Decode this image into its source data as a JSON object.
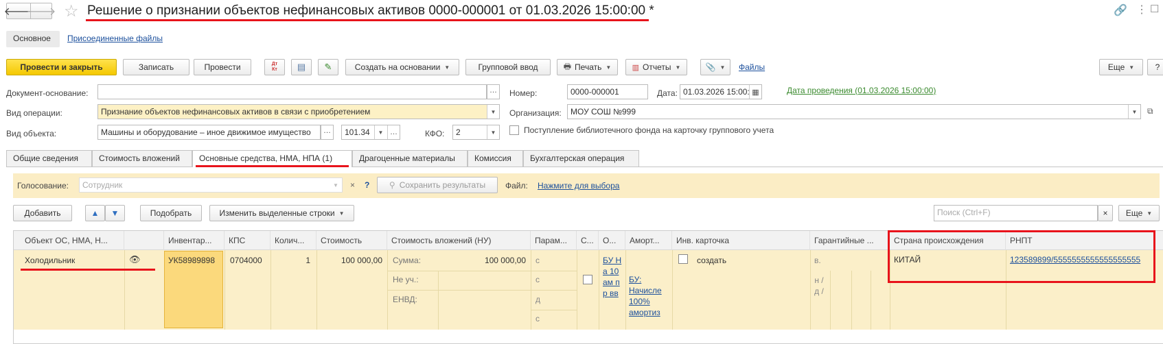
{
  "title": "Решение о признании объектов нефинансовых активов 0000-000001 от 01.03.2026 15:00:00 *",
  "view_tabs": [
    "Основное",
    "Присоединенные файлы"
  ],
  "toolbar": {
    "post_close": "Провести и закрыть",
    "save": "Записать",
    "post": "Провести",
    "dtkt": "Дт\nКт",
    "create_based": "Создать на основании",
    "group_input": "Групповой ввод",
    "print": "Печать",
    "reports": "Отчеты",
    "files": "Файлы",
    "more": "Еще",
    "help": "?"
  },
  "form": {
    "doc_basis_label": "Документ-основание:",
    "doc_basis_value": "",
    "number_label": "Номер:",
    "number_value": "0000-000001",
    "date_label": "Дата:",
    "date_value": "01.03.2026 15:00:00",
    "posting_link": "Дата проведения (01.03.2026 15:00:00)",
    "op_type_label": "Вид операции:",
    "op_type_value": "Признание объектов нефинансовых активов в связи с приобретением",
    "org_label": "Организация:",
    "org_value": "МОУ СОШ №999",
    "obj_type_label": "Вид объекта:",
    "obj_type_value": "Машины и оборудование – иное движимое имущество",
    "account_value": "101.34",
    "kfo_label": "КФО:",
    "kfo_value": "2",
    "library_checkbox_label": "Поступление библиотечного фонда на карточку группового учета"
  },
  "doc_tabs": [
    "Общие сведения",
    "Стоимость вложений",
    "Основные средства, НМА, НПА (1)",
    "Драгоценные материалы",
    "Комиссия",
    "Бухгалтерская операция"
  ],
  "voting": {
    "label": "Голосование:",
    "placeholder": "Сотрудник",
    "help": "?",
    "save_results": "Сохранить результаты",
    "file_label": "Файл:",
    "file_link": "Нажмите для выбора"
  },
  "table_toolbar": {
    "add": "Добавить",
    "pick": "Подобрать",
    "change_rows": "Изменить выделенные строки",
    "search_placeholder": "Поиск (Ctrl+F)",
    "more": "Еще"
  },
  "columns": [
    "Объект ОС, НМА, Н...",
    "Инвентар...",
    "КПС",
    "Колич...",
    "Стоимость",
    "Стоимость вложений (НУ)",
    "Парам...",
    "С...",
    "О...",
    "Аморт...",
    "Инв. карточка",
    "Гарантийные ...",
    "Страна происхождения",
    "РНПТ"
  ],
  "row": {
    "object": "Холодильник",
    "inventory": "УК58989898",
    "kps": "0704000",
    "qty": "1",
    "cost": "100 000,00",
    "sum_label": "Сумма:",
    "sum_value": "100 000,00",
    "not_taken_label": "Не уч.:",
    "envd_label": "ЕНВД:",
    "param_c1": "с",
    "param_c2": "с",
    "param_d": "д",
    "param_c3": "с",
    "o_link": "БУ На 10 ам пр вв",
    "amort_link": "БУ: Начисле 100% амортиз",
    "inv_card": "создать",
    "guarantee_v": "в.",
    "guarantee_nd": "н / д /",
    "country": "КИТАЙ",
    "rnpt": "123589899/5555555555555555555"
  }
}
